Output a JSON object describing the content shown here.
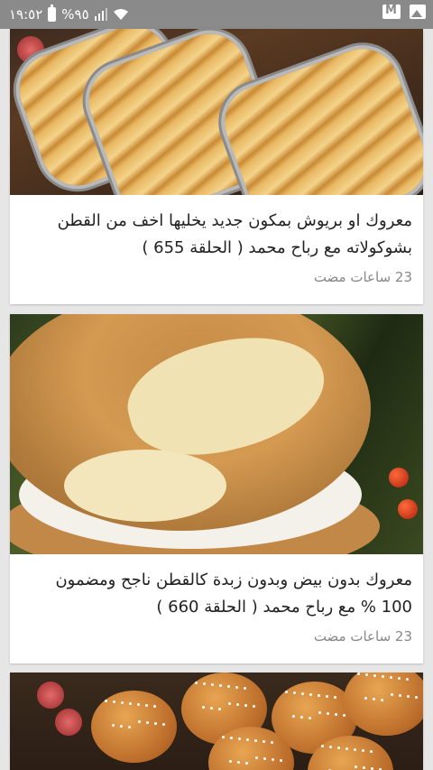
{
  "status_bar": {
    "time": "١٩:٥٢",
    "battery": "%٩٥",
    "icons": [
      "battery-icon",
      "signal-icon",
      "wifi-icon",
      "mail-app-icon",
      "gallery-app-icon"
    ]
  },
  "articles": [
    {
      "title": "معروك او بريوش بمكون جديد يخليها اخف من القطن بشوكولاته مع رباح محمد ( الحلقة 655 )",
      "time": "23 ساعات مضت"
    },
    {
      "title": "معروك  بدون بيض وبدون زبدة كالقطن ناجح ومضمون 100 % مع رباح محمد ( الحلقة 660 )",
      "time": "23 ساعات مضت"
    }
  ],
  "colors": {
    "status_bar": "#8a8a8a",
    "background": "#e6e6e6",
    "card": "#ffffff",
    "title_text": "#222222",
    "time_text": "#888888"
  }
}
